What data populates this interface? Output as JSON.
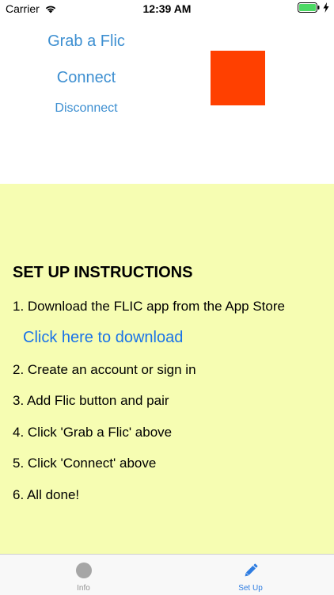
{
  "status_bar": {
    "carrier": "Carrier",
    "time": "12:39 AM"
  },
  "controls": {
    "grab_label": "Grab a Flic",
    "connect_label": "Connect",
    "disconnect_label": "Disconnect",
    "connection_indicator_color": "#ff4000",
    "link_color": "#3d8fd1"
  },
  "instructions": {
    "background_color": "#f6fdb2",
    "title": "SET UP INSTRUCTIONS",
    "step1": "1. Download the FLIC app from the App Store",
    "download_link": "Click here to download",
    "step2": "2. Create an account or sign in",
    "step3": "3. Add Flic button and pair",
    "step4": "4. Click 'Grab a Flic' above",
    "step5": "5. Click 'Connect' above",
    "step6": "6. All done!"
  },
  "tab_bar": {
    "tabs": [
      {
        "label": "Info",
        "icon": "circle-icon",
        "selected": false
      },
      {
        "label": "Set Up",
        "icon": "pencil-icon",
        "selected": true
      }
    ],
    "selected_color": "#2f7de1",
    "unselected_color": "#929292"
  }
}
